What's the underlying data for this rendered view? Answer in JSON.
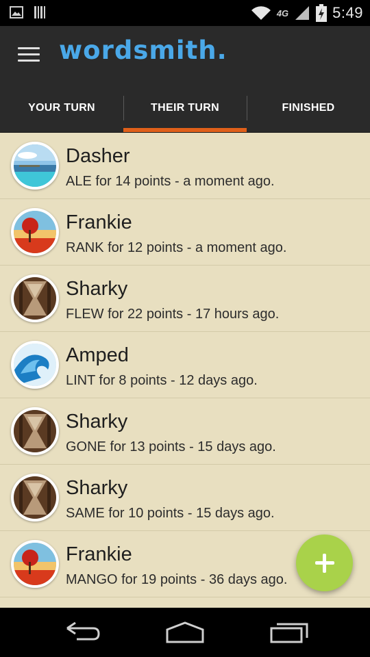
{
  "status_bar": {
    "time": "5:49",
    "network": "4G",
    "icons": [
      "image-icon",
      "barcode-icon",
      "wifi-icon",
      "signal-icon",
      "battery-icon"
    ]
  },
  "app": {
    "title": "wordsmith.",
    "menu_icon": "hamburger-menu-icon",
    "brand_color": "#4aa8e8"
  },
  "tabs": [
    {
      "label": "YOUR TURN",
      "active": false
    },
    {
      "label": "THEIR TURN",
      "active": true
    },
    {
      "label": "FINISHED",
      "active": false
    }
  ],
  "accent_color": "#e0601a",
  "games": [
    {
      "name": "Dasher",
      "detail": "ALE for 14 points - a moment ago.",
      "avatar": "beach"
    },
    {
      "name": "Frankie",
      "detail": "RANK for 12 points - a moment ago.",
      "avatar": "red-tree"
    },
    {
      "name": "Sharky",
      "detail": "FLEW for 22 points - 17 hours ago.",
      "avatar": "hourglass"
    },
    {
      "name": "Amped",
      "detail": "LINT for 8 points - 12 days ago.",
      "avatar": "wave"
    },
    {
      "name": "Sharky",
      "detail": "GONE for 13 points - 15 days ago.",
      "avatar": "hourglass"
    },
    {
      "name": "Sharky",
      "detail": "SAME for 10 points - 15 days ago.",
      "avatar": "hourglass"
    },
    {
      "name": "Frankie",
      "detail": "MANGO for 19 points - 36 days ago.",
      "avatar": "red-tree"
    }
  ],
  "fab": {
    "icon": "plus-icon",
    "color": "#a9d24a"
  },
  "nav_bar": {
    "icons": [
      "back-icon",
      "home-icon",
      "recent-apps-icon"
    ]
  }
}
